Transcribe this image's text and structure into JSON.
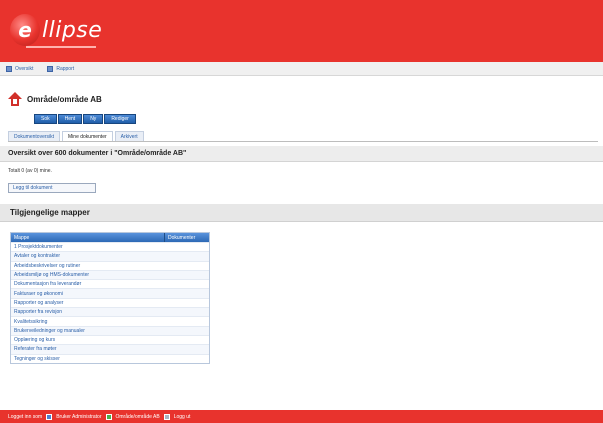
{
  "app": {
    "logo_text": "llipse",
    "logo_letter": "e"
  },
  "userbar": {
    "items": [
      "Oversikt",
      "Rapport"
    ]
  },
  "page": {
    "title": "Område/område AB"
  },
  "buttons": [
    "Sok",
    "Hent",
    "Ny",
    "Rediger"
  ],
  "tabs": [
    "Dokumentoversikt",
    "Mine dokumenter",
    "Arkivert"
  ],
  "doc_heading": "Oversikt over 600 dokumenter i \"Område/område AB\"",
  "sub_text": "Totalt 0 (av 0) mine.",
  "action_button": "Legg til dokument",
  "section_heading": "Tilgjengelige mapper",
  "table": {
    "col1": "Mappe",
    "col2": "Dokumenter",
    "rows": [
      "1 Prosjektdokumenter",
      "Avtaler og kontrakter",
      "Arbeidsbeskrivelser og rutiner",
      "Arbeidsmiljø og HMS-dokumenter",
      "Dokumentasjon fra leverandør",
      "Fakturaer og økonomi",
      "Rapporter og analyser",
      "Rapporter fra revisjon",
      "Kvalitetssikring",
      "Brukerveiledninger og manualer",
      "Opplæring og kurs",
      "Referater fra møter",
      "Tegninger og skisser"
    ]
  },
  "footer": {
    "text1": "Logget inn som",
    "text2": "Bruker Administrator",
    "text3": "Område/område AB",
    "text4": "Logg ut"
  },
  "colors": {
    "brand": "#e8332d",
    "link": "#2a5fa8",
    "button": "#2d69b5"
  }
}
